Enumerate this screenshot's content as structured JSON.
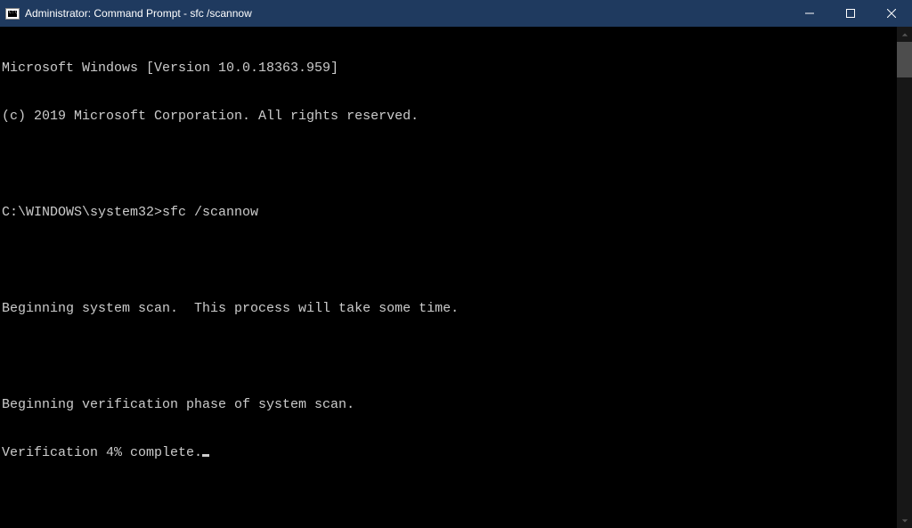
{
  "window": {
    "title": "Administrator: Command Prompt - sfc  /scannow"
  },
  "terminal": {
    "lines": [
      "Microsoft Windows [Version 10.0.18363.959]",
      "(c) 2019 Microsoft Corporation. All rights reserved.",
      "",
      "C:\\WINDOWS\\system32>sfc /scannow",
      "",
      "Beginning system scan.  This process will take some time.",
      "",
      "Beginning verification phase of system scan.",
      "Verification 4% complete."
    ]
  }
}
